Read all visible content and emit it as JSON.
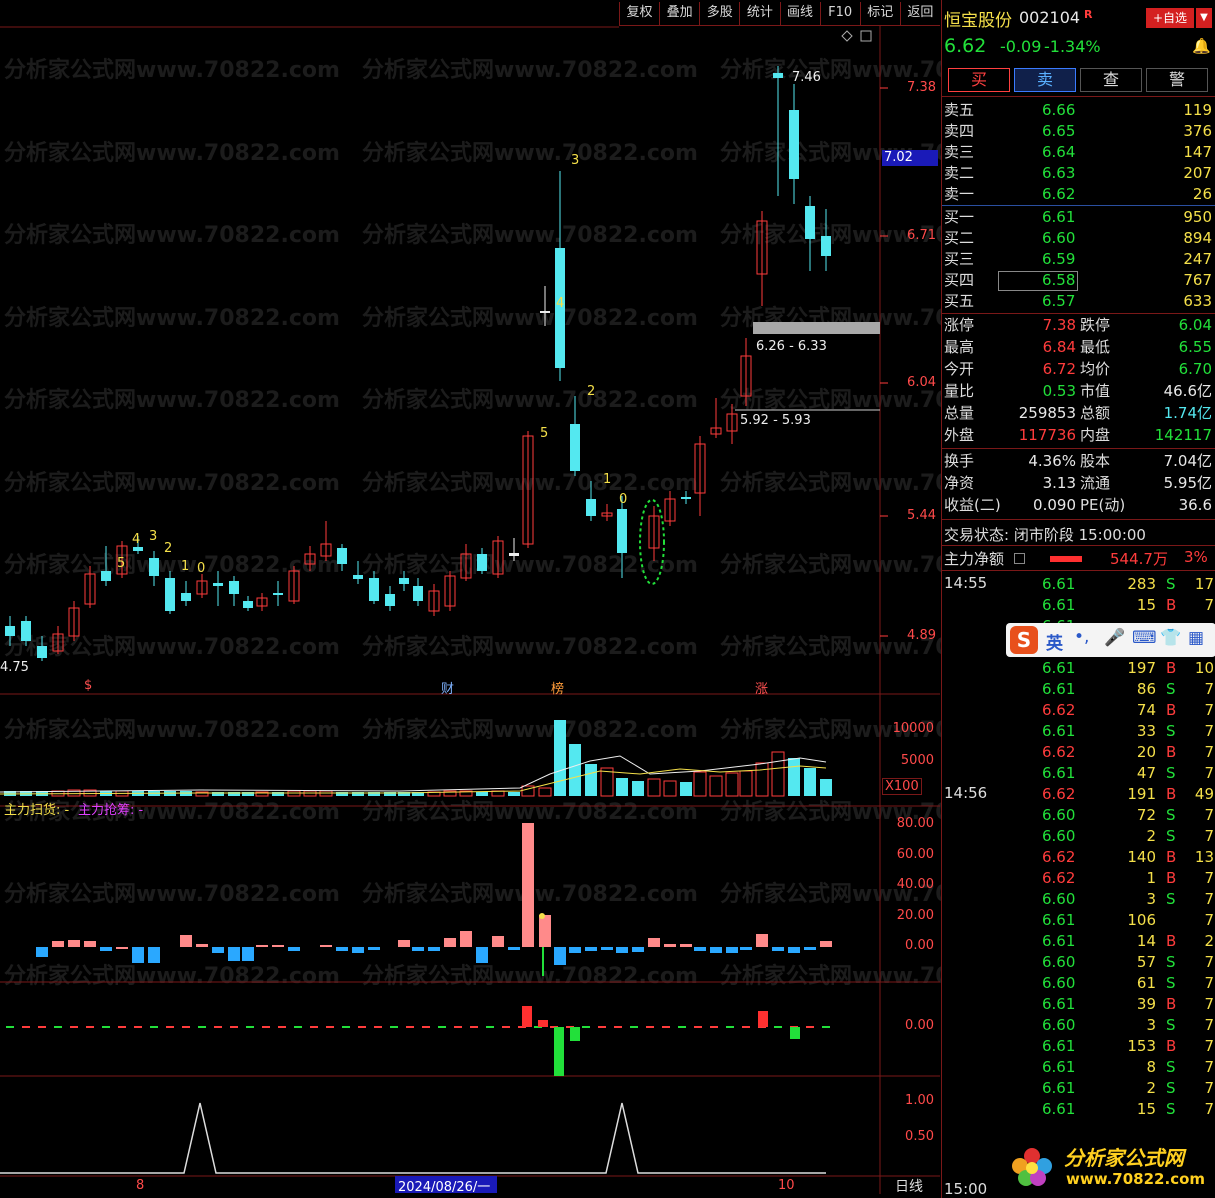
{
  "toolbar": [
    "复权",
    "叠加",
    "多股",
    "统计",
    "画线",
    "F10",
    "标记",
    "返回"
  ],
  "watermark": "分析家公式网www.70822.com",
  "y_axis_labels": [
    "7.38",
    "6.71",
    "6.04",
    "5.44",
    "4.89"
  ],
  "current_price_box": "7.02",
  "annotations": {
    "high_label": "7.46",
    "low_label": "4.75",
    "zone1": "6.26 - 6.33",
    "zone2": "5.92 - 5.93",
    "event_s": "$",
    "event_cai": "财",
    "event_bang": "榜",
    "event_zhang": "涨"
  },
  "td_counts": [
    "5",
    "4",
    "3",
    "2",
    "1",
    "0",
    "3",
    "4",
    "5",
    "2",
    "1",
    "0"
  ],
  "volume_axis": [
    "10000",
    "5000",
    "X100"
  ],
  "indicator_legend": {
    "a": "主力扫货: -",
    "b": "主力抢筹: -"
  },
  "ind_axis": [
    "80.00",
    "60.00",
    "40.00",
    "20.00",
    "0.00"
  ],
  "ind2_axis": [
    "0.00"
  ],
  "ind3_axis": [
    "1.00",
    "0.50"
  ],
  "date_axis": {
    "left": "8",
    "mid": "2024/08/26/一",
    "right": "10",
    "period": "日线"
  },
  "stock": {
    "name": "恒宝股份",
    "code": "002104",
    "flag": "R",
    "add_btn": "+自选",
    "price": "6.62",
    "change": "-0.09",
    "pct": "-1.34%"
  },
  "trade_buttons": [
    "买",
    "卖",
    "查",
    "警"
  ],
  "asks": [
    {
      "label": "卖五",
      "price": "6.66",
      "vol": "119"
    },
    {
      "label": "卖四",
      "price": "6.65",
      "vol": "376"
    },
    {
      "label": "卖三",
      "price": "6.64",
      "vol": "147"
    },
    {
      "label": "卖二",
      "price": "6.63",
      "vol": "207"
    },
    {
      "label": "卖一",
      "price": "6.62",
      "vol": "26"
    }
  ],
  "bids": [
    {
      "label": "买一",
      "price": "6.61",
      "vol": "950"
    },
    {
      "label": "买二",
      "price": "6.60",
      "vol": "894"
    },
    {
      "label": "买三",
      "price": "6.59",
      "vol": "247"
    },
    {
      "label": "买四",
      "price": "6.58",
      "vol": "767"
    },
    {
      "label": "买五",
      "price": "6.57",
      "vol": "633"
    }
  ],
  "stats": [
    {
      "l1": "涨停",
      "v1": "7.38",
      "c1": "red",
      "l2": "跌停",
      "v2": "6.04",
      "c2": "grn"
    },
    {
      "l1": "最高",
      "v1": "6.84",
      "c1": "red",
      "l2": "最低",
      "v2": "6.55",
      "c2": "grn"
    },
    {
      "l1": "今开",
      "v1": "6.72",
      "c1": "red",
      "l2": "均价",
      "v2": "6.70",
      "c2": "grn"
    },
    {
      "l1": "量比",
      "v1": "0.53",
      "c1": "grn",
      "l2": "市值",
      "v2": "46.6亿",
      "c2": "wht"
    },
    {
      "l1": "总量",
      "v1": "259853",
      "c1": "wht",
      "l2": "总额",
      "v2": "1.74亿",
      "c2": "cyan"
    },
    {
      "l1": "外盘",
      "v1": "117736",
      "c1": "red",
      "l2": "内盘",
      "v2": "142117",
      "c2": "grn"
    }
  ],
  "stats2": [
    {
      "l1": "换手",
      "v1": "4.36%",
      "l2": "股本",
      "v2": "7.04亿"
    },
    {
      "l1": "净资",
      "v1": "3.13",
      "l2": "流通",
      "v2": "5.95亿"
    },
    {
      "l1": "收益(二)",
      "v1": "0.090",
      "l2": "PE(动)",
      "v2": "36.6"
    }
  ],
  "trade_state": "交易状态: 闭市阶段 15:00:00",
  "main_net": {
    "label": "主力净额",
    "value": "544.7万",
    "pct": "3%"
  },
  "ticks_time1": "14:55",
  "ticks_time2": "14:56",
  "ticks_time3": "15:00",
  "ime": "英",
  "ticks": [
    {
      "p": "6.61",
      "v": "283",
      "s": "S",
      "x": "17"
    },
    {
      "p": "6.61",
      "v": "15",
      "s": "B",
      "x": "7"
    },
    {
      "p": "6.61",
      "v": "",
      "s": "",
      "x": ""
    },
    {
      "p": "6.61",
      "v": "4",
      "s": "B",
      "x": "7"
    },
    {
      "p": "6.61",
      "v": "197",
      "s": "B",
      "x": "10"
    },
    {
      "p": "6.61",
      "v": "86",
      "s": "S",
      "x": "7"
    },
    {
      "p": "6.62",
      "v": "74",
      "s": "B",
      "x": "7"
    },
    {
      "p": "6.61",
      "v": "33",
      "s": "S",
      "x": "7"
    },
    {
      "p": "6.62",
      "v": "20",
      "s": "B",
      "x": "7"
    },
    {
      "p": "6.61",
      "v": "47",
      "s": "S",
      "x": "7"
    },
    {
      "p": "6.62",
      "v": "191",
      "s": "B",
      "x": "49"
    },
    {
      "p": "6.60",
      "v": "72",
      "s": "S",
      "x": "7"
    },
    {
      "p": "6.60",
      "v": "2",
      "s": "S",
      "x": "7"
    },
    {
      "p": "6.62",
      "v": "140",
      "s": "B",
      "x": "13"
    },
    {
      "p": "6.62",
      "v": "1",
      "s": "B",
      "x": "7"
    },
    {
      "p": "6.60",
      "v": "3",
      "s": "S",
      "x": "7"
    },
    {
      "p": "6.61",
      "v": "106",
      "s": "",
      "x": "7"
    },
    {
      "p": "6.61",
      "v": "14",
      "s": "B",
      "x": "2"
    },
    {
      "p": "6.60",
      "v": "57",
      "s": "S",
      "x": "7"
    },
    {
      "p": "6.60",
      "v": "61",
      "s": "S",
      "x": "7"
    },
    {
      "p": "6.61",
      "v": "39",
      "s": "B",
      "x": "7"
    },
    {
      "p": "6.60",
      "v": "3",
      "s": "S",
      "x": "7"
    },
    {
      "p": "6.61",
      "v": "153",
      "s": "B",
      "x": "7"
    },
    {
      "p": "6.61",
      "v": "8",
      "s": "S",
      "x": "7"
    },
    {
      "p": "6.61",
      "v": "2",
      "s": "S",
      "x": "7"
    },
    {
      "p": "6.61",
      "v": "15",
      "s": "S",
      "x": "7"
    }
  ],
  "logo": {
    "text": "分析家公式网",
    "url": "www.70822.com"
  }
}
